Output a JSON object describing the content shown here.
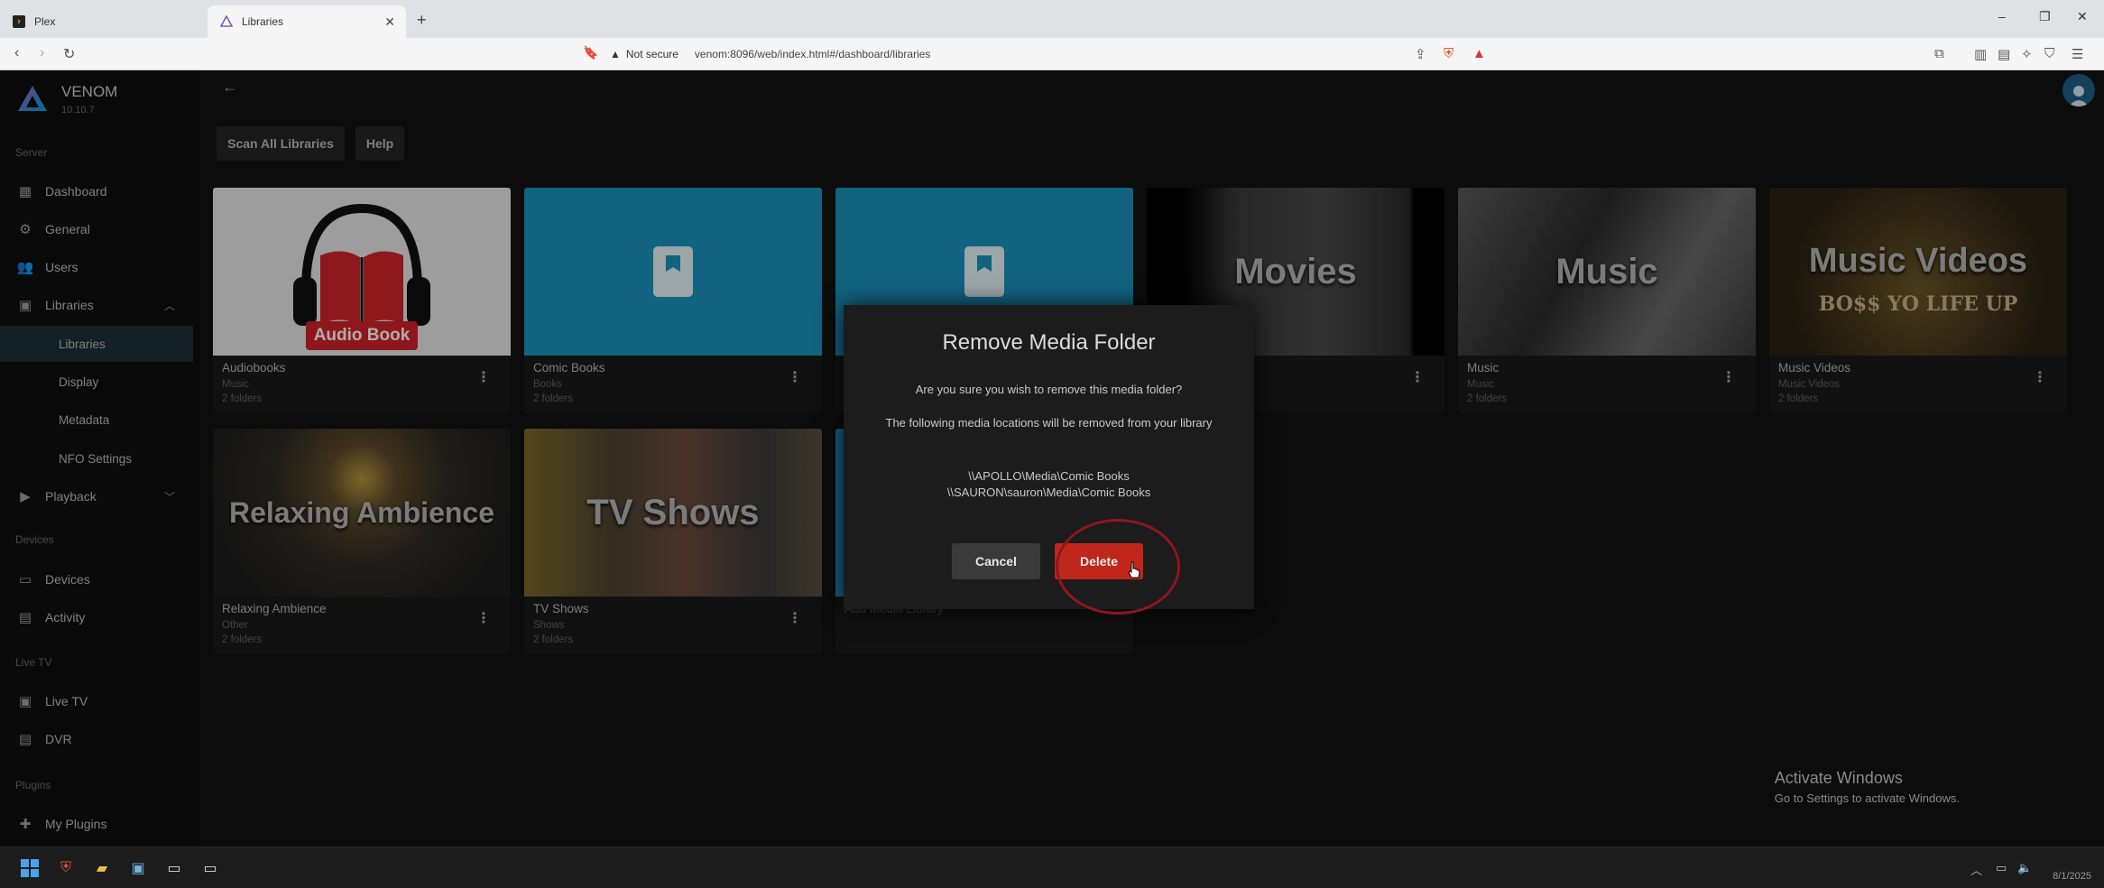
{
  "browser": {
    "tabs": [
      {
        "label": "Plex"
      },
      {
        "label": "Libraries"
      }
    ],
    "security": "Not secure",
    "url": "venom:8096/web/index.html#/dashboard/libraries"
  },
  "brand": {
    "name": "VENOM",
    "version": "10.10.7"
  },
  "sidebar": {
    "sections": {
      "server": "Server",
      "devices": "Devices",
      "livetv": "Live TV",
      "plugins": "Plugins"
    },
    "items": {
      "dashboard": "Dashboard",
      "general": "General",
      "users": "Users",
      "libraries": "Libraries",
      "libraries_sub": "Libraries",
      "display": "Display",
      "metadata": "Metadata",
      "nfo": "NFO Settings",
      "playback": "Playback",
      "devices": "Devices",
      "activity": "Activity",
      "livetv": "Live TV",
      "dvr": "DVR",
      "myplugins": "My Plugins"
    }
  },
  "toolbar": {
    "scan": "Scan All Libraries",
    "help": "Help"
  },
  "libraries": [
    {
      "title": "Audiobooks",
      "type": "Music",
      "count": "2 folders",
      "art": "Audio Book"
    },
    {
      "title": "Comic Books",
      "type": "Books",
      "count": "2 folders",
      "art": ""
    },
    {
      "title": "",
      "type": "",
      "count": "",
      "art": ""
    },
    {
      "title": "",
      "type": "",
      "count": "",
      "art": "Movies"
    },
    {
      "title": "Music",
      "type": "Music",
      "count": "2 folders",
      "art": "Music"
    },
    {
      "title": "Music Videos",
      "type": "Music Videos",
      "count": "2 folders",
      "art": "Music Videos"
    },
    {
      "title": "Relaxing Ambience",
      "type": "Other",
      "count": "2 folders",
      "art": "Relaxing Ambience"
    },
    {
      "title": "TV Shows",
      "type": "Shows",
      "count": "2 folders",
      "art": "TV Shows"
    },
    {
      "title": "Add Media Library",
      "type": "",
      "count": "",
      "art": ""
    }
  ],
  "music_videos_art_text": "BO$$ YO LIFE UP",
  "dialog": {
    "title": "Remove Media Folder",
    "question": "Are you sure you wish to remove this media folder?",
    "message": "The following media locations will be removed from your library",
    "locations": [
      "\\\\APOLLO\\Media\\Comic Books",
      "\\\\SAURON\\sauron\\Media\\Comic Books"
    ],
    "cancel": "Cancel",
    "delete": "Delete"
  },
  "watermark": {
    "line1": "Activate Windows",
    "line2": "Go to Settings to activate Windows."
  },
  "taskbar": {
    "date": "8/1/2025"
  },
  "colors": {
    "accent": "#00a4dc",
    "danger": "#c0271a",
    "selected_nav": "#1d3037",
    "comic_tile": "#1a93bd"
  }
}
